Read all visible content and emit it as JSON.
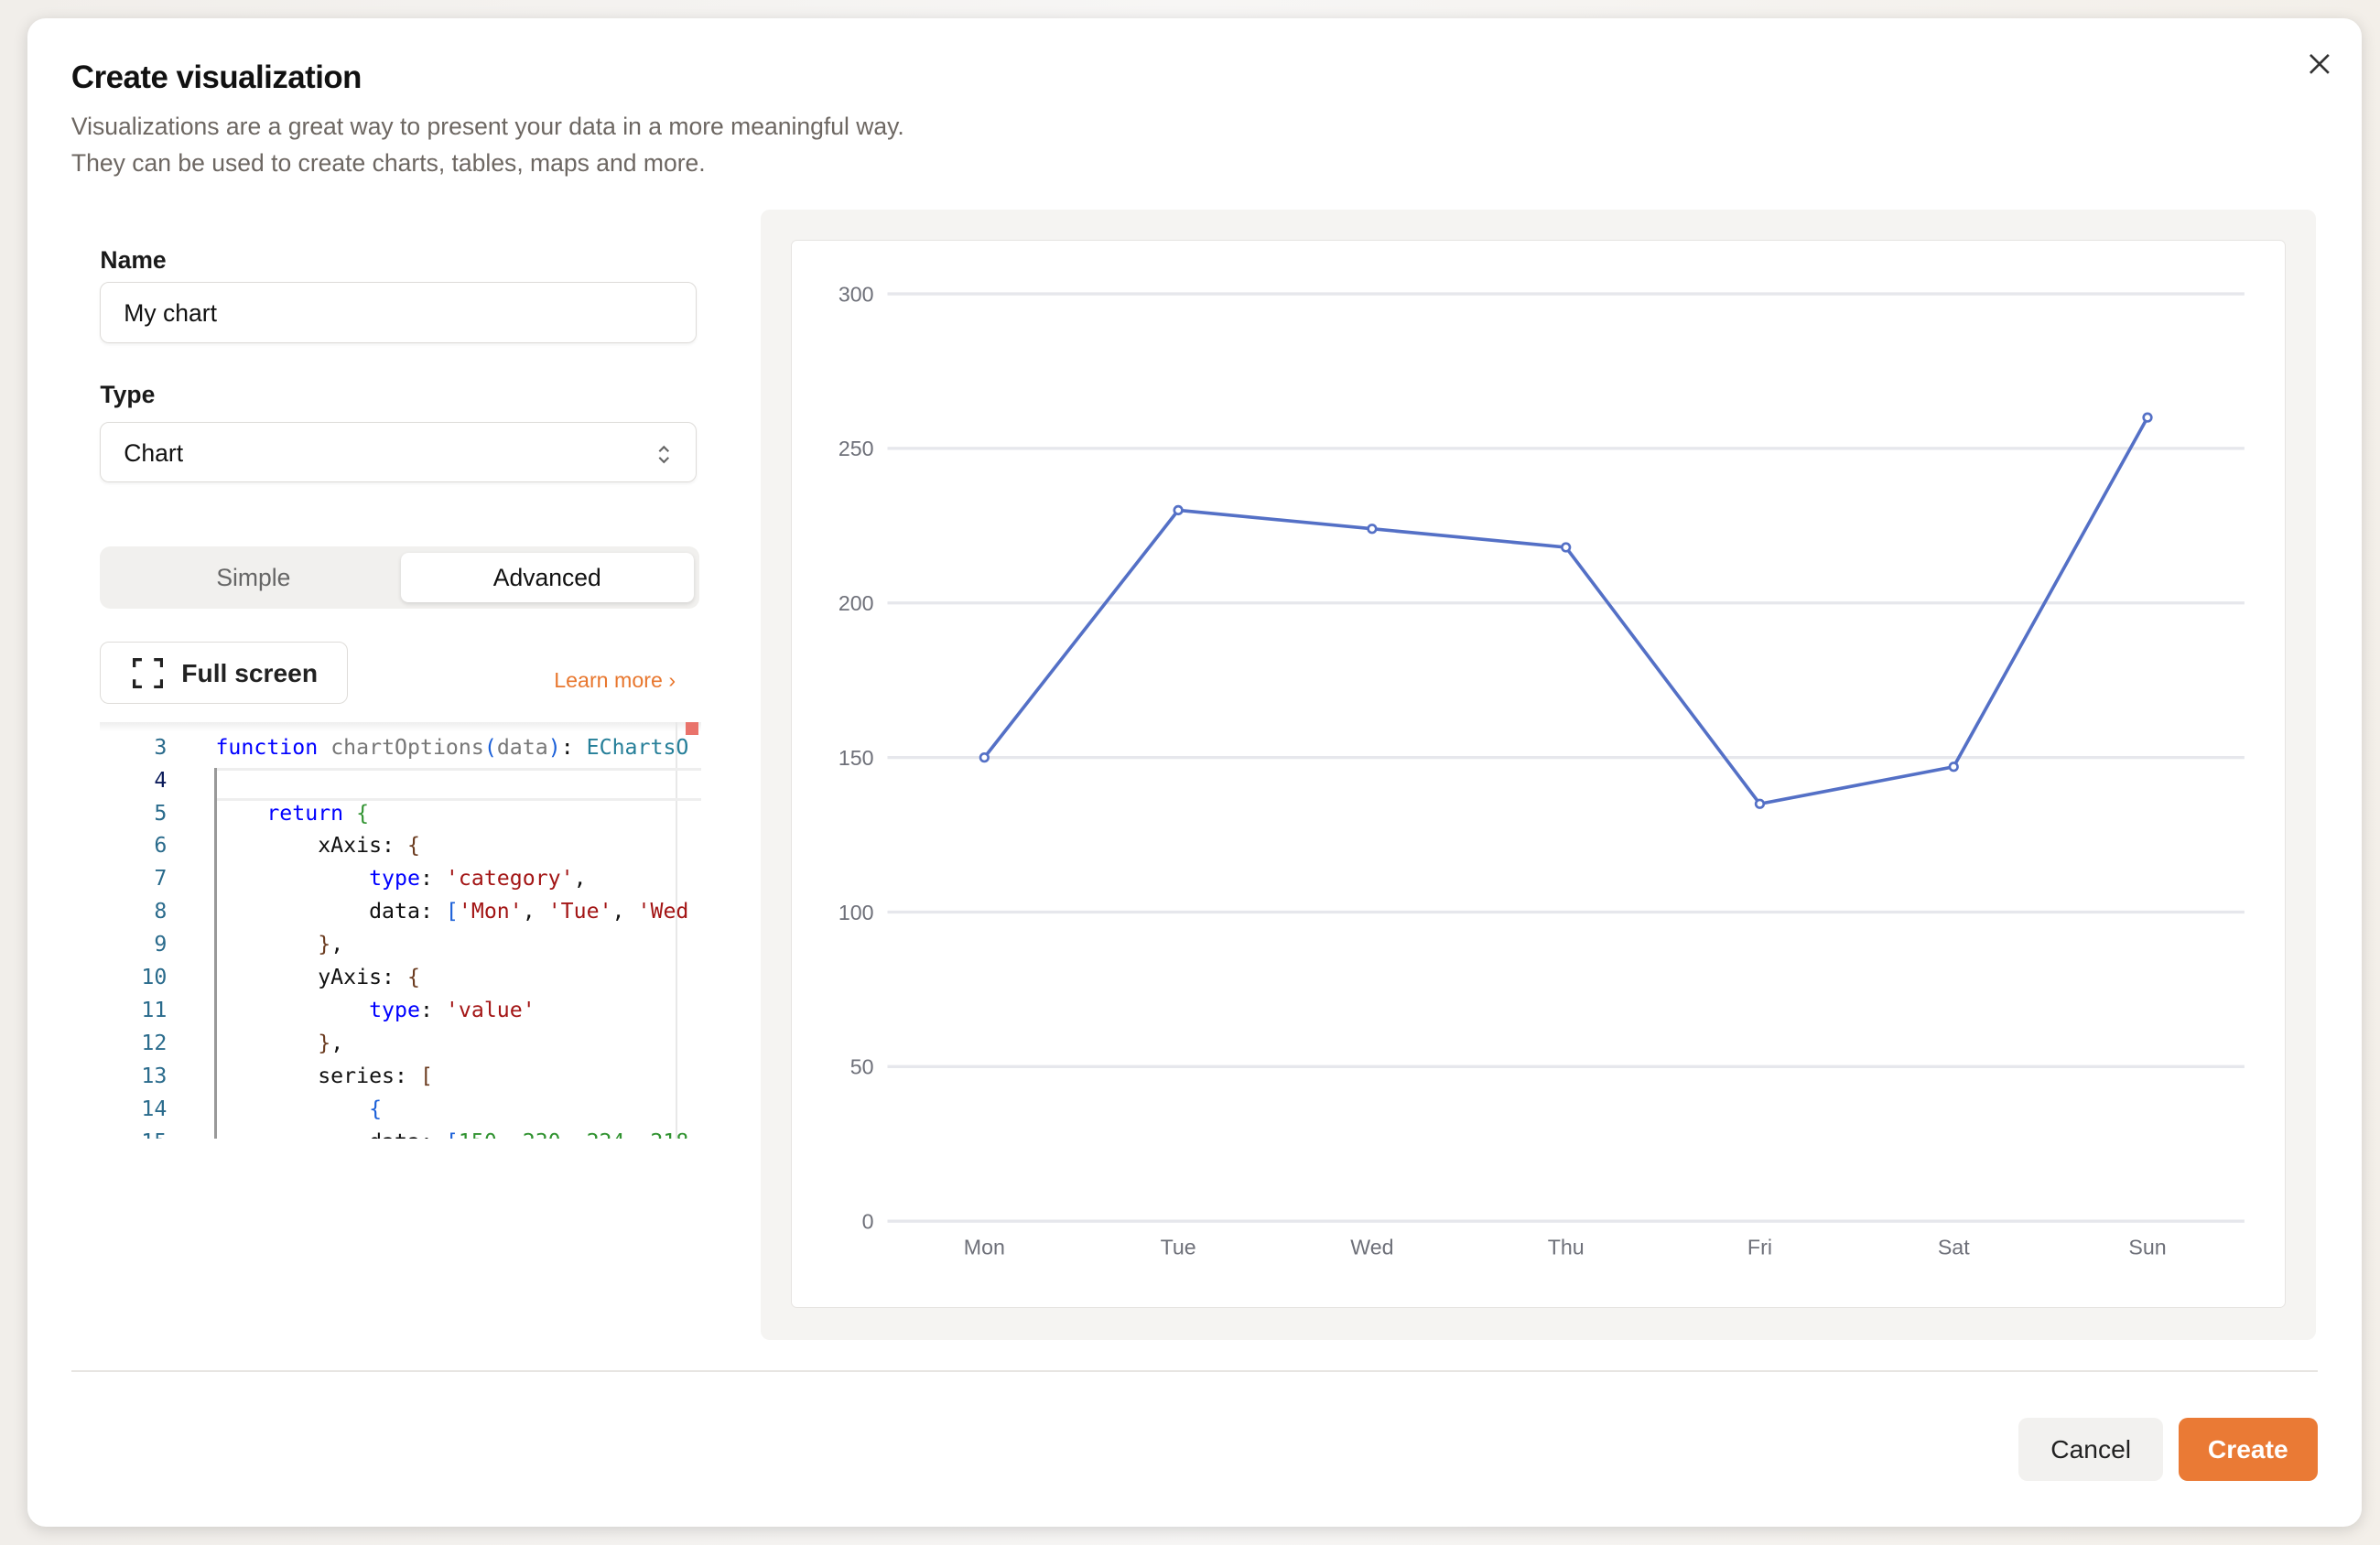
{
  "dialog": {
    "title": "Create visualization",
    "subtitle_1": "Visualizations are a great way to present your data in a more meaningful way.",
    "subtitle_2": "They can be used to create charts, tables, maps and more."
  },
  "form": {
    "name_label": "Name",
    "name_value": "My chart",
    "type_label": "Type",
    "type_value": "Chart",
    "modes": [
      "Simple",
      "Advanced"
    ],
    "active_mode": "Advanced",
    "fullscreen_label": "Full screen",
    "learn_more": "Learn more"
  },
  "editor": {
    "lines": [
      {
        "n": "3",
        "html": "<span class='k'>function</span> <span class='g'>chartOptions</span><span class='b2'>(</span><span class='g'>data</span><span class='b2'>)</span>: <span class='t'>EChartsO</span>"
      },
      {
        "n": "4",
        "html": ""
      },
      {
        "n": "5",
        "html": "    <span class='k'>return</span> <span class='gr'>{</span>"
      },
      {
        "n": "6",
        "html": "        xAxis: <span class='b1'>{</span>"
      },
      {
        "n": "7",
        "html": "            <span class='k'>type</span>: <span class='s'>'category'</span>,"
      },
      {
        "n": "8",
        "html": "            data: <span class='b2'>[</span><span class='s'>'Mon'</span>, <span class='s'>'Tue'</span>, <span class='s'>'Wed</span>"
      },
      {
        "n": "9",
        "html": "        <span class='b1'>}</span>,"
      },
      {
        "n": "10",
        "html": "        yAxis: <span class='b1'>{</span>"
      },
      {
        "n": "11",
        "html": "            <span class='k'>type</span>: <span class='s'>'value'</span>"
      },
      {
        "n": "12",
        "html": "        <span class='b1'>}</span>,"
      },
      {
        "n": "13",
        "html": "        series: <span class='b1'>[</span>"
      },
      {
        "n": "14",
        "html": "            <span class='b2'>{</span>"
      },
      {
        "n": "15",
        "html": "            data: <span class='b2'>[</span><span class='gr'>150, 230, 224, 218</span>"
      }
    ]
  },
  "footer": {
    "cancel": "Cancel",
    "create": "Create"
  },
  "colors": {
    "accent": "#ea7a35",
    "series": "#5470c6"
  },
  "chart_data": {
    "type": "line",
    "categories": [
      "Mon",
      "Tue",
      "Wed",
      "Thu",
      "Fri",
      "Sat",
      "Sun"
    ],
    "values": [
      150,
      230,
      224,
      218,
      135,
      147,
      260
    ],
    "ylim": [
      0,
      300
    ],
    "yticks": [
      0,
      50,
      100,
      150,
      200,
      250,
      300
    ],
    "grid": true,
    "title": "",
    "xlabel": "",
    "ylabel": ""
  }
}
